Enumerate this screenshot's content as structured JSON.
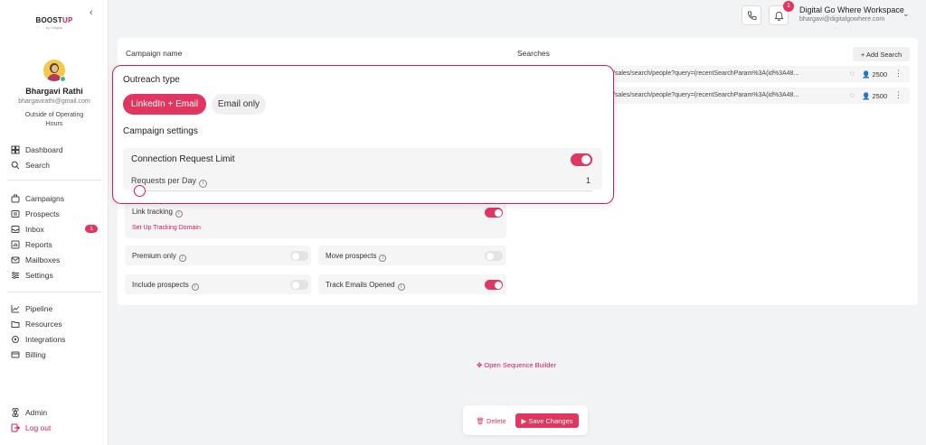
{
  "brand": {
    "name_main": "BOOST",
    "name_accent": "UP",
    "tagline": "by Xdigital"
  },
  "user": {
    "name": "Bhargavi Rathi",
    "email": "bhargavirathi@gmail.com",
    "status": "Outside of Operating Hours"
  },
  "nav": {
    "group1": [
      {
        "label": "Dashboard",
        "icon": "dashboard-icon"
      },
      {
        "label": "Search",
        "icon": "search-icon"
      }
    ],
    "group2": [
      {
        "label": "Campaigns",
        "icon": "campaigns-icon"
      },
      {
        "label": "Prospects",
        "icon": "prospects-icon"
      },
      {
        "label": "Inbox",
        "icon": "inbox-icon",
        "badge": "1"
      },
      {
        "label": "Reports",
        "icon": "reports-icon"
      },
      {
        "label": "Mailboxes",
        "icon": "mailboxes-icon"
      },
      {
        "label": "Settings",
        "icon": "settings-sliders-icon"
      }
    ],
    "group3": [
      {
        "label": "Pipeline",
        "icon": "pipeline-icon"
      },
      {
        "label": "Resources",
        "icon": "resources-folder-icon"
      },
      {
        "label": "Integrations",
        "icon": "integrations-icon"
      },
      {
        "label": "Billing",
        "icon": "billing-icon"
      }
    ],
    "admin": "Admin",
    "logout": "Log out"
  },
  "header": {
    "notif_count": "1",
    "workspace_name": "Digital Go Where Workspace",
    "workspace_email": "bhargavi@digitalgowhere.com"
  },
  "campaign": {
    "name_label": "Campaign name",
    "searches_label": "Searches",
    "add_search": "+ Add Search",
    "searches": [
      {
        "url": "/sales/search/people?query=(recentSearchParam%3A(id%3A48...",
        "count": "2500"
      },
      {
        "url": "/sales/search/people?query=(recentSearchParam%3A(id%3A48...",
        "count": "2500"
      }
    ],
    "settings": {
      "link_tracking": "Link tracking",
      "setup_domain": "Set Up Tracking Domain",
      "premium_only": "Premium only",
      "move_prospects": "Move prospects",
      "include_prospects": "Include prospects",
      "track_emails": "Track Emails Opened"
    },
    "toggles": {
      "link_tracking": true,
      "premium_only": false,
      "move_prospects": false,
      "include_prospects": false,
      "track_emails": true
    }
  },
  "popup": {
    "outreach_title": "Outreach type",
    "options": [
      "LinkedIn + Email",
      "Email only"
    ],
    "selected": "LinkedIn + Email",
    "settings_title": "Campaign settings",
    "conn_limit": "Connection Request Limit",
    "conn_limit_on": true,
    "requests_per_day": "Requests per Day",
    "requests_value": "1"
  },
  "footer": {
    "open_sequence": "Open Sequence Builder",
    "delete": "Delete",
    "save": "Save Changes"
  },
  "colors": {
    "accent": "#e0365f",
    "accent_dark": "#d81b60",
    "online": "#3cb878"
  }
}
